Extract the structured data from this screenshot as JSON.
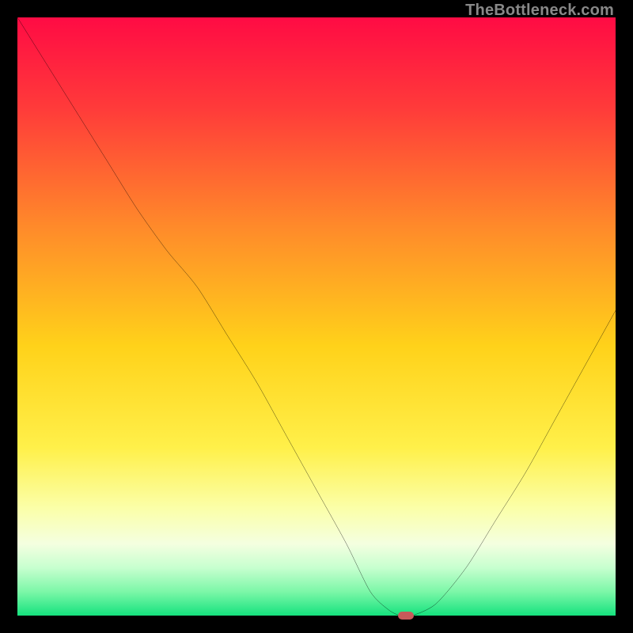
{
  "watermark": "TheBottleneck.com",
  "chart_data": {
    "type": "line",
    "title": "",
    "xlabel": "",
    "ylabel": "",
    "xlim": [
      0,
      100
    ],
    "ylim": [
      0,
      100
    ],
    "x": [
      0,
      5,
      10,
      15,
      20,
      25,
      30,
      35,
      40,
      45,
      50,
      55,
      59,
      62,
      64,
      66,
      70,
      75,
      80,
      85,
      90,
      95,
      100
    ],
    "values": [
      100,
      92,
      84,
      76,
      68,
      61,
      55,
      47,
      39,
      30,
      21,
      12,
      4,
      1,
      0,
      0,
      2,
      8,
      16,
      24,
      33,
      42,
      51
    ],
    "marker": {
      "x": 65,
      "y": 0
    },
    "gradient_stops": [
      {
        "pos": 0.0,
        "color": "#ff0b44"
      },
      {
        "pos": 0.15,
        "color": "#ff3a3a"
      },
      {
        "pos": 0.35,
        "color": "#ff8a2a"
      },
      {
        "pos": 0.55,
        "color": "#ffd21a"
      },
      {
        "pos": 0.72,
        "color": "#fff04a"
      },
      {
        "pos": 0.82,
        "color": "#fbffa8"
      },
      {
        "pos": 0.88,
        "color": "#f4ffe0"
      },
      {
        "pos": 0.92,
        "color": "#c7ffcf"
      },
      {
        "pos": 0.96,
        "color": "#7cf7a8"
      },
      {
        "pos": 1.0,
        "color": "#15e27e"
      }
    ]
  }
}
